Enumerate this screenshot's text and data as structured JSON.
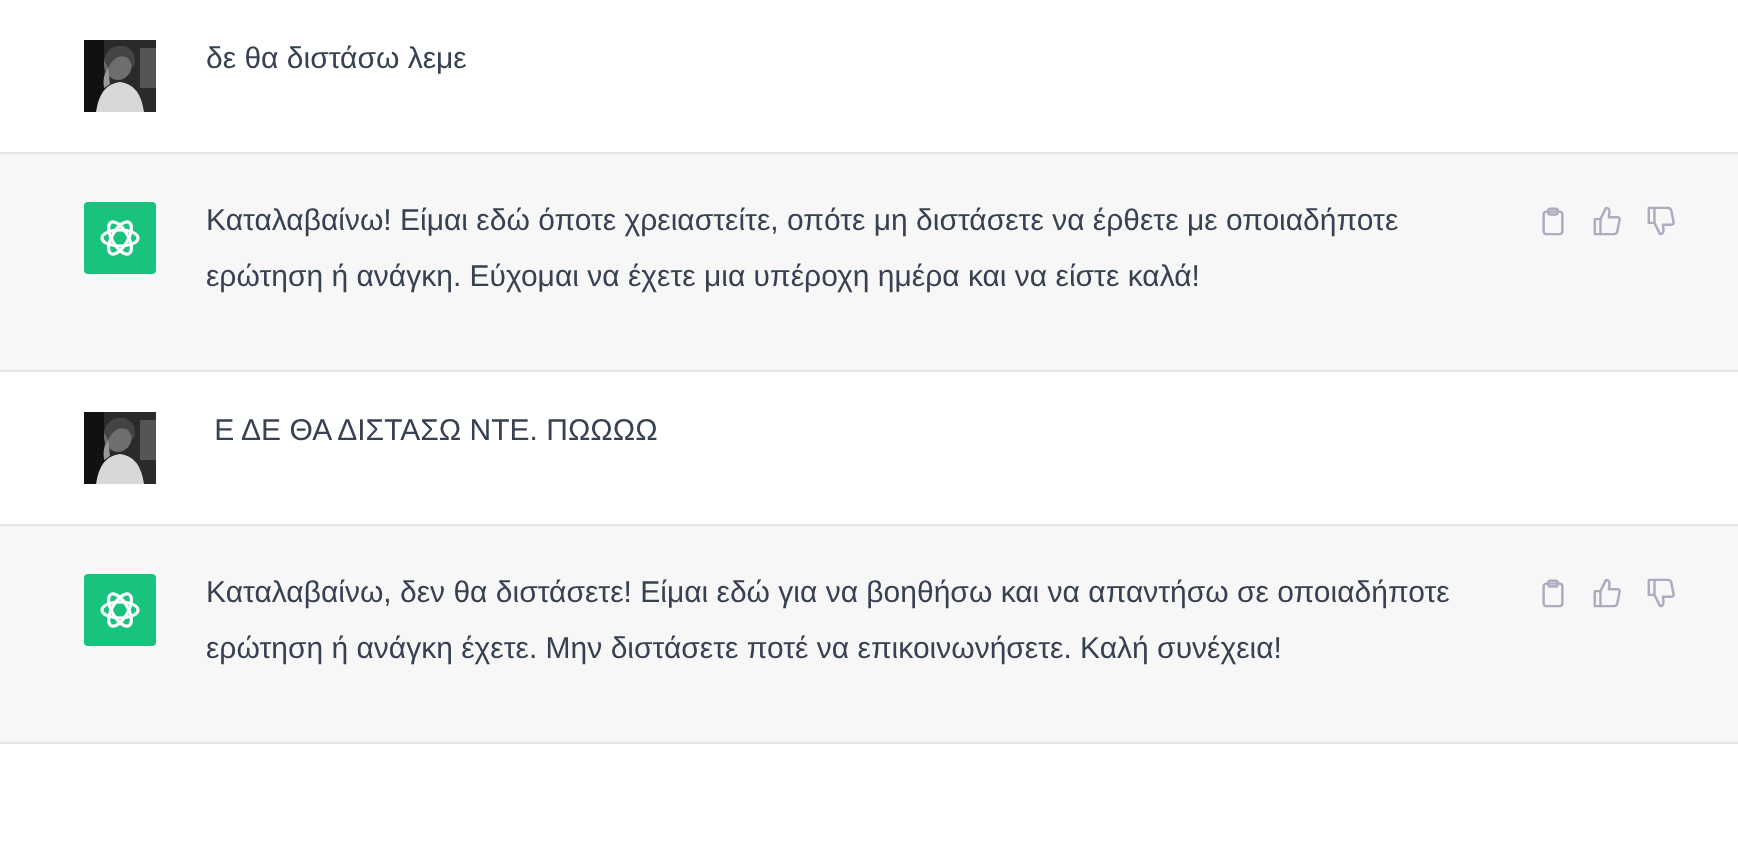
{
  "messages": [
    {
      "kind": "user",
      "text": "δε θα διστάσω λεμε"
    },
    {
      "kind": "assistant",
      "text": "Καταλαβαίνω! Είμαι εδώ όποτε χρειαστείτε, οπότε μη διστάσετε να έρθετε με οποιαδήποτε ερώτηση ή ανάγκη. Εύχομαι να έχετε μια υπέροχη ημέρα και να είστε καλά!"
    },
    {
      "kind": "user",
      "text": " Ε ΔΕ ΘΑ ΔΙΣΤΑΣΩ ΝΤΕ. ΠΩΩΩΩ"
    },
    {
      "kind": "assistant",
      "text": "Καταλαβαίνω, δεν θα διστάσετε! Είμαι εδώ για να βοηθήσω και να απαντήσω σε οποιαδήποτε ερώτηση ή ανάγκη έχετε. Μην διστάσετε ποτέ να επικοινωνήσετε. Καλή συνέχεια!"
    }
  ]
}
